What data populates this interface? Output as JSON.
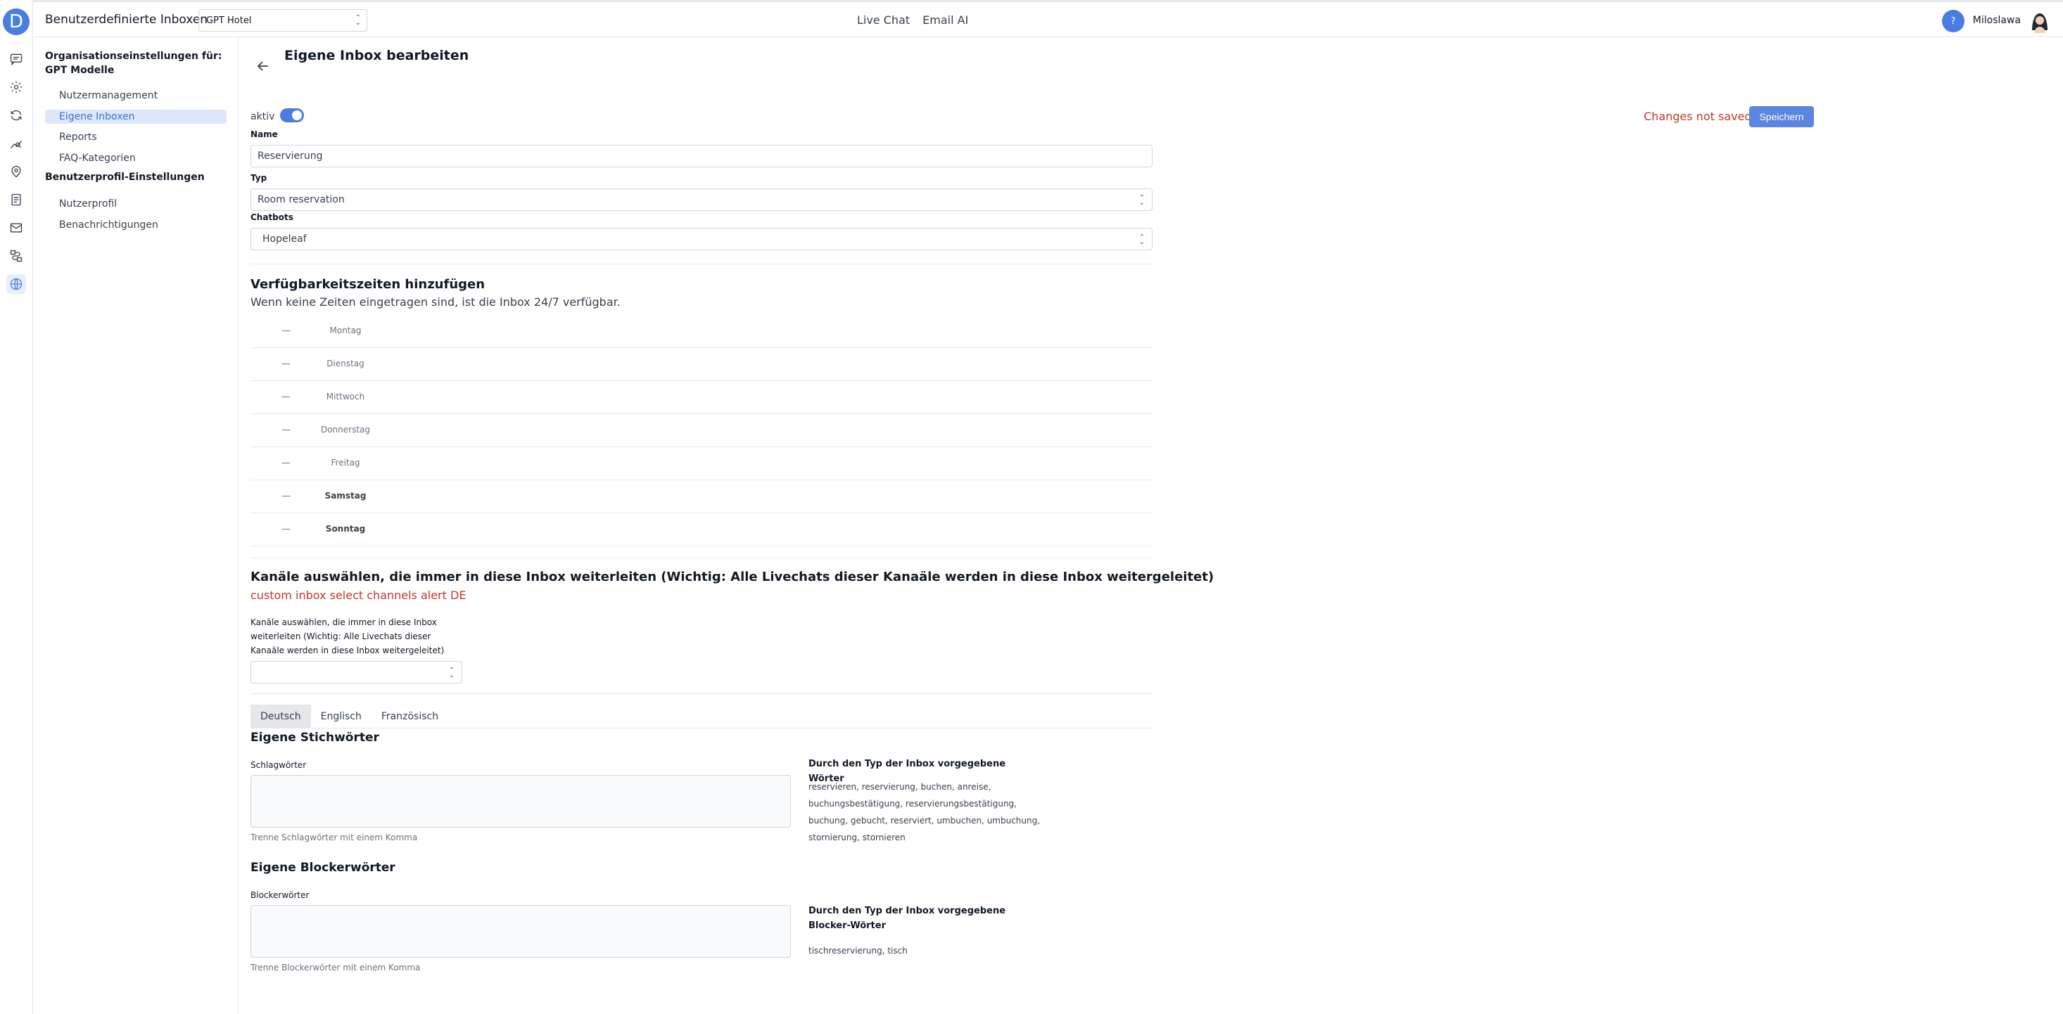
{
  "header": {
    "app_title": "Benutzerdefinierte Inboxen",
    "hotel_select": "GPT Hotel",
    "nav": [
      "Live Chat",
      "Email AI"
    ],
    "help_label": "?",
    "user_name": "Miloslawa",
    "logo_letter": "D"
  },
  "rail": {
    "icons": [
      "chat-icon",
      "gear-icon",
      "sync-icon",
      "analytics-icon",
      "location-icon",
      "document-icon",
      "mail-icon",
      "workflow-icon",
      "globe-icon"
    ]
  },
  "sidebar": {
    "org_heading": "Organisationseinstellungen für:  GPT Modelle",
    "org_items": [
      {
        "label": "Nutzermanagement",
        "active": false
      },
      {
        "label": "Eigene Inboxen",
        "active": true
      },
      {
        "label": "Reports",
        "active": false
      },
      {
        "label": "FAQ-Kategorien",
        "active": false
      }
    ],
    "profile_heading": "Benutzerprofil-Einstellungen",
    "profile_items": [
      {
        "label": "Nutzerprofil"
      },
      {
        "label": "Benachrichtigungen"
      }
    ]
  },
  "main": {
    "page_title": "Eigene Inbox bearbeiten",
    "aktiv_label": "aktiv",
    "aktiv_on": true,
    "unsaved": "Changes not saved",
    "save_label": "Speichern",
    "name_label": "Name",
    "name_value": "Reservierung",
    "typ_label": "Typ",
    "typ_value": "Room reservation",
    "chatbots_label": "Chatbots",
    "chatbots_value": "Hopeleaf",
    "availability_title": "Verfügbarkeitszeiten hinzufügen",
    "availability_sub": "Wenn keine Zeiten eingetragen sind, ist die Inbox 24/7 verfügbar.",
    "days": [
      {
        "dash": "—",
        "name": "Montag",
        "bold": false
      },
      {
        "dash": "—",
        "name": "Dienstag",
        "bold": false
      },
      {
        "dash": "—",
        "name": "Mittwoch",
        "bold": false
      },
      {
        "dash": "—",
        "name": "Donnerstag",
        "bold": false
      },
      {
        "dash": "—",
        "name": "Freitag",
        "bold": false
      },
      {
        "dash": "—",
        "name": "Samstag",
        "bold": true
      },
      {
        "dash": "—",
        "name": "Sonntag",
        "bold": true
      }
    ],
    "channels_title": "Kanäle auswählen, die immer in diese Inbox weiterleiten (Wichtig: Alle Livechats dieser Kanaäle werden in diese Inbox weitergeleitet)",
    "channels_alert": "custom inbox select channels alert DE",
    "channels_label": "Kanäle auswählen, die immer in diese Inbox weiterleiten (Wichtig: Alle Livechats dieser Kanaäle werden in diese Inbox weitergeleitet)",
    "channels_value": "",
    "tabs": [
      {
        "label": "Deutsch",
        "active": true
      },
      {
        "label": "Englisch",
        "active": false
      },
      {
        "label": "Französisch",
        "active": false
      }
    ],
    "keywords_title": "Eigene Stichwörter",
    "keywords_label": "Schlagwörter",
    "keywords_hint": "Trenne Schlagwörter mit einem Komma",
    "preset_keywords_title": "Durch den Typ der Inbox vorgegebene Wörter",
    "preset_keywords": "reservieren, reservierung, buchen, anreise, buchungsbestätigung, reservierungsbestätigung, buchung, gebucht, reserviert, umbuchen, umbuchung, stornierung, stornieren",
    "blockers_title": "Eigene Blockerwörter",
    "blockers_label": "Blockerwörter",
    "blockers_hint": "Trenne Blockerwörter mit einem Komma",
    "preset_blockers_title": "Durch den Typ der Inbox vorgegebene Blocker-Wörter",
    "preset_blockers": "tischreservierung, tisch"
  }
}
